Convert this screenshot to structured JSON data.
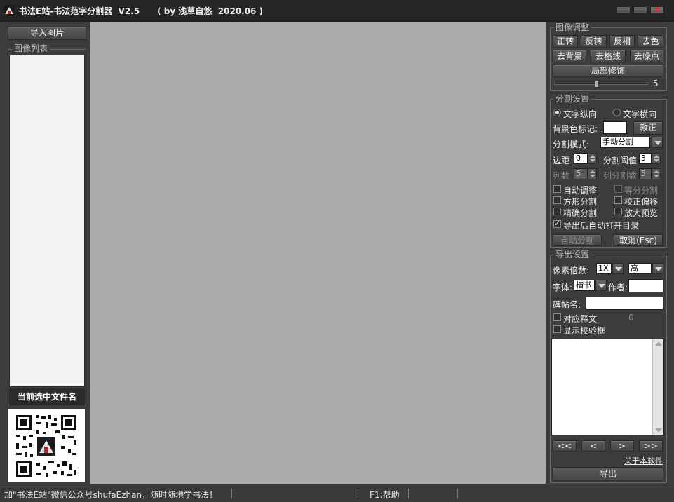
{
  "window": {
    "title": "书法E站-书法范字分割器  V2.5      ( by 浅草自悠  2020.06 )"
  },
  "left_panel": {
    "import_button": "导入图片",
    "image_list_title": "图像列表",
    "current_file_label": "当前选中文件名"
  },
  "image_adjust": {
    "title": "图像调整",
    "buttons": [
      "正转",
      "反转",
      "反相",
      "去色",
      "去背景",
      "去格线",
      "去噪点"
    ],
    "local_fix_button": "局部修饰",
    "slider_value": "5",
    "slider_fraction": 0.45
  },
  "split_settings": {
    "title": "分割设置",
    "radio_vertical": "文字纵向",
    "radio_horizontal": "文字横向",
    "radio_selected": "vertical",
    "bg_color_label": "背景色标记:",
    "correct_button": "教正",
    "mode_label": "分割模式:",
    "mode_value": "手动分割",
    "margin_label": "边距",
    "margin_value": "0",
    "threshold_label": "分割阈值",
    "threshold_value": "3",
    "columns_label": "列数",
    "columns_value": "5",
    "col_split_label": "列分割数",
    "col_split_value": "5",
    "checkboxes": {
      "auto_adjust": "自动调整",
      "equal_split": "等分分割",
      "square_split": "方形分割",
      "correct_offset": "校正偏移",
      "precise_split": "精确分割",
      "zoom_preview": "放大预览",
      "open_dir": "导出后自动打开目录"
    },
    "auto_split_button": "自动分割",
    "cancel_button": "取消(Esc)"
  },
  "export_settings": {
    "title": "导出设置",
    "pixel_label": "像素倍数:",
    "pixel_value": "1X",
    "quality_value": "高",
    "font_label": "字体:",
    "font_value": "楷书",
    "author_label": "作者:",
    "author_value": "",
    "stele_label": "碑帖名:",
    "stele_value": "",
    "match_text_label": "对应释文",
    "match_count": "0",
    "show_check_label": "显示校验框",
    "nav_first": "<<",
    "nav_prev": "<",
    "nav_next": ">",
    "nav_last": ">>",
    "about_link": "关于本软件",
    "export_button": "导出"
  },
  "status_bar": {
    "message": "加\"书法E站\"微信公众号shufaEzhan，随时随地学书法！",
    "help": "F1:帮助"
  },
  "colors": {
    "background": "#3c3c3c",
    "canvas": "#ababab",
    "list_bg": "#f2f2f2"
  },
  "icons": [
    "app-logo-icon",
    "minimize-icon",
    "maximize-icon",
    "close-icon",
    "qr-code-icon"
  ]
}
